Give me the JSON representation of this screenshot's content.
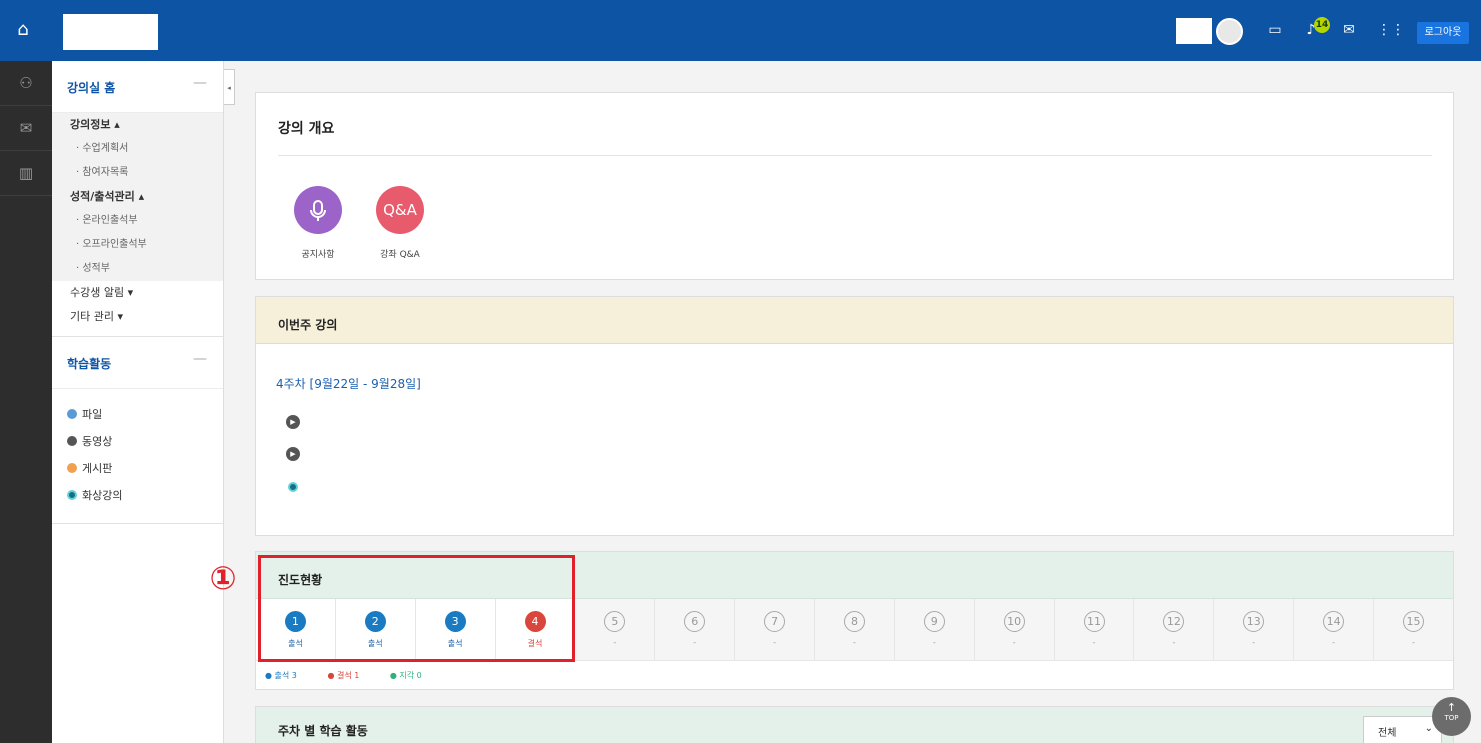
{
  "topbar": {
    "logout_label": "로그아웃",
    "notification_count": "14"
  },
  "sidebar": {
    "home_label": "강의실 홈",
    "collapse_symbol": "—",
    "menu": [
      {
        "label": "강의정보 ▴"
      },
      {
        "label": "· 수업계획서"
      },
      {
        "label": "· 참여자목록"
      },
      {
        "label": "성적/출석관리 ▴"
      },
      {
        "label": "· 온라인출석부"
      },
      {
        "label": "· 오프라인출석부"
      },
      {
        "label": "· 성적부"
      },
      {
        "label": "수강생 알림 ▾"
      },
      {
        "label": "기타 관리 ▾"
      }
    ],
    "activities_label": "학습활동",
    "activities": [
      {
        "label": "파일",
        "color": "#5b9bd5"
      },
      {
        "label": "동영상",
        "color": "#555555"
      },
      {
        "label": "게시판",
        "color": "#f0a050"
      },
      {
        "label": "화상강의",
        "color": "#1b6b8a"
      }
    ]
  },
  "overview": {
    "title": "강의 개요",
    "items": [
      {
        "label": "공지사항",
        "color": "#9c63c9",
        "icon": "microphone-icon"
      },
      {
        "label": "강좌 Q&A",
        "text": "Q&A",
        "color": "#e85b6d"
      }
    ]
  },
  "this_week": {
    "title": "이번주 강의",
    "week_link": "4주차 [9월22일 - 9월28일]"
  },
  "progress": {
    "title": "진도현황",
    "weeks": [
      {
        "n": "1",
        "status": "출석",
        "state": "present"
      },
      {
        "n": "2",
        "status": "출석",
        "state": "present"
      },
      {
        "n": "3",
        "status": "출석",
        "state": "present"
      },
      {
        "n": "4",
        "status": "결석",
        "state": "absent"
      },
      {
        "n": "5",
        "status": "-",
        "state": "none"
      },
      {
        "n": "6",
        "status": "-",
        "state": "none"
      },
      {
        "n": "7",
        "status": "-",
        "state": "none"
      },
      {
        "n": "8",
        "status": "-",
        "state": "none"
      },
      {
        "n": "9",
        "status": "-",
        "state": "none"
      },
      {
        "n": "10",
        "status": "-",
        "state": "none"
      },
      {
        "n": "11",
        "status": "-",
        "state": "none"
      },
      {
        "n": "12",
        "status": "-",
        "state": "none"
      },
      {
        "n": "13",
        "status": "-",
        "state": "none"
      },
      {
        "n": "14",
        "status": "-",
        "state": "none"
      },
      {
        "n": "15",
        "status": "-",
        "state": "none"
      }
    ],
    "legend": {
      "present": "● 출석 3",
      "absent": "● 결석 1",
      "late": "● 지각 0"
    },
    "marker": "①"
  },
  "weekly_activity": {
    "title": "주차 별 학습 활동",
    "filter_value": "전체"
  },
  "totop": {
    "label": "TOP"
  }
}
